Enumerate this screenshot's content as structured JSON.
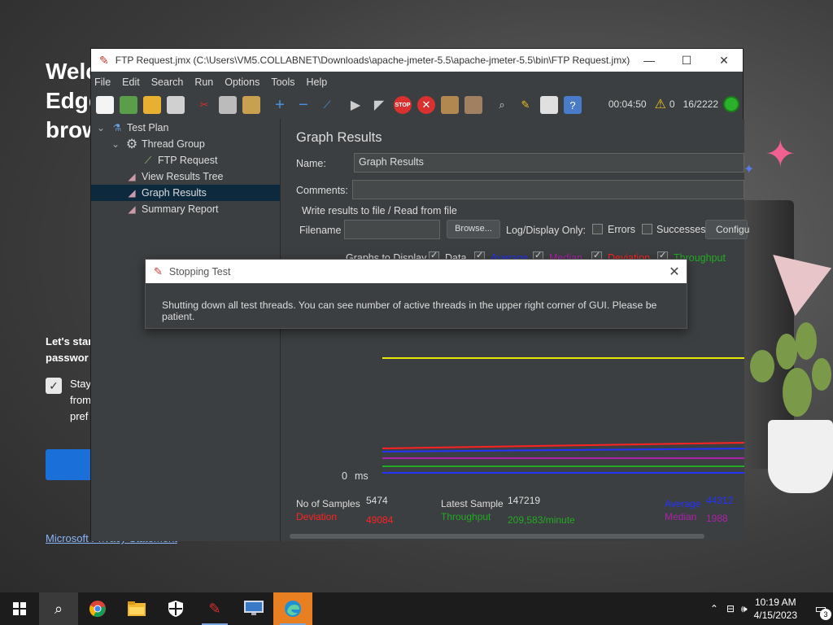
{
  "edge": {
    "heading_lines": [
      "Welc",
      "Edge",
      "brow"
    ],
    "sub_lines": [
      "Let's star",
      "passwor"
    ],
    "stay_lines": [
      "Stay",
      "from",
      "pref"
    ],
    "privacy_link": "Microsoft Privacy Statement"
  },
  "jmeter": {
    "title": "FTP Request.jmx (C:\\Users\\VM5.COLLABNET\\Downloads\\apache-jmeter-5.5\\apache-jmeter-5.5\\bin\\FTP Request.jmx) ...",
    "menu": [
      "File",
      "Edit",
      "Search",
      "Run",
      "Options",
      "Tools",
      "Help"
    ],
    "toolbar_icons": [
      "new-icon",
      "templates-icon",
      "open-icon",
      "save-icon",
      "cut-icon",
      "copy-icon",
      "paste-icon",
      "expand-icon",
      "collapse-icon",
      "toggle-icon",
      "start-icon",
      "start-no-pauses-icon",
      "stop-icon",
      "shutdown-icon",
      "clear-icon",
      "clear-all-icon",
      "search-icon",
      "reset-search-icon",
      "function-helper-icon",
      "help-icon"
    ],
    "status": {
      "elapsed": "00:04:50",
      "warnings": "0",
      "threads": "16/2222"
    },
    "tree": [
      {
        "label": "Test Plan",
        "icon": "test-plan-icon",
        "level": 0,
        "expander": "⌄"
      },
      {
        "label": "Thread Group",
        "icon": "gear-icon",
        "level": 1,
        "expander": "⌄"
      },
      {
        "label": "FTP Request",
        "icon": "pipette-icon",
        "level": 2,
        "expander": ""
      },
      {
        "label": "View Results Tree",
        "icon": "listener-icon",
        "level": 1,
        "expander": ""
      },
      {
        "label": "Graph Results",
        "icon": "listener-icon",
        "level": 1,
        "expander": "",
        "selected": true
      },
      {
        "label": "Summary Report",
        "icon": "listener-icon",
        "level": 1,
        "expander": ""
      }
    ],
    "panel": {
      "title": "Graph Results",
      "name_label": "Name:",
      "name_value": "Graph Results",
      "comments_label": "Comments:",
      "comments_value": "",
      "file_section": "Write results to file / Read from file",
      "filename_label": "Filename",
      "filename_value": "",
      "browse_label": "Browse...",
      "log_display_label": "Log/Display Only:",
      "errors_label": "Errors",
      "successes_label": "Successes",
      "configure_label": "Configu",
      "graphs_label": "Graphs to Display",
      "graph_options": [
        {
          "label": "Data",
          "color": "#dddddd"
        },
        {
          "label": "Average",
          "color": "#2233ff"
        },
        {
          "label": "Median",
          "color": "#aa22aa"
        },
        {
          "label": "Deviation",
          "color": "#ff2222"
        },
        {
          "label": "Throughput",
          "color": "#22aa22"
        }
      ],
      "axis_zero": "0",
      "axis_unit": "ms",
      "stats": {
        "samples_label": "No of Samples",
        "samples_value": "5474",
        "latest_label": "Latest Sample",
        "latest_value": "147219",
        "average_label": "Average",
        "average_value": "44312",
        "deviation_label": "Deviation",
        "deviation_value": "49084",
        "throughput_label": "Throughput",
        "throughput_value": "209,583/minute",
        "median_label": "Median",
        "median_value": "1988"
      }
    }
  },
  "dialog": {
    "title": "Stopping Test",
    "message": "Shutting down all test threads. You can see number of active threads in the upper right corner of GUI. Please be patient."
  },
  "taskbar": {
    "apps": [
      "start-icon",
      "search-icon",
      "chrome-icon",
      "file-explorer-icon",
      "security-icon",
      "jmeter-icon",
      "remote-desktop-icon",
      "edge-icon"
    ],
    "time": "10:19 AM",
    "date": "4/15/2023",
    "notifications": "3"
  },
  "colors": {
    "selected_tree": "#0d293e",
    "jmeter_bg": "#3c3f41",
    "stop_red": "#d93030"
  }
}
